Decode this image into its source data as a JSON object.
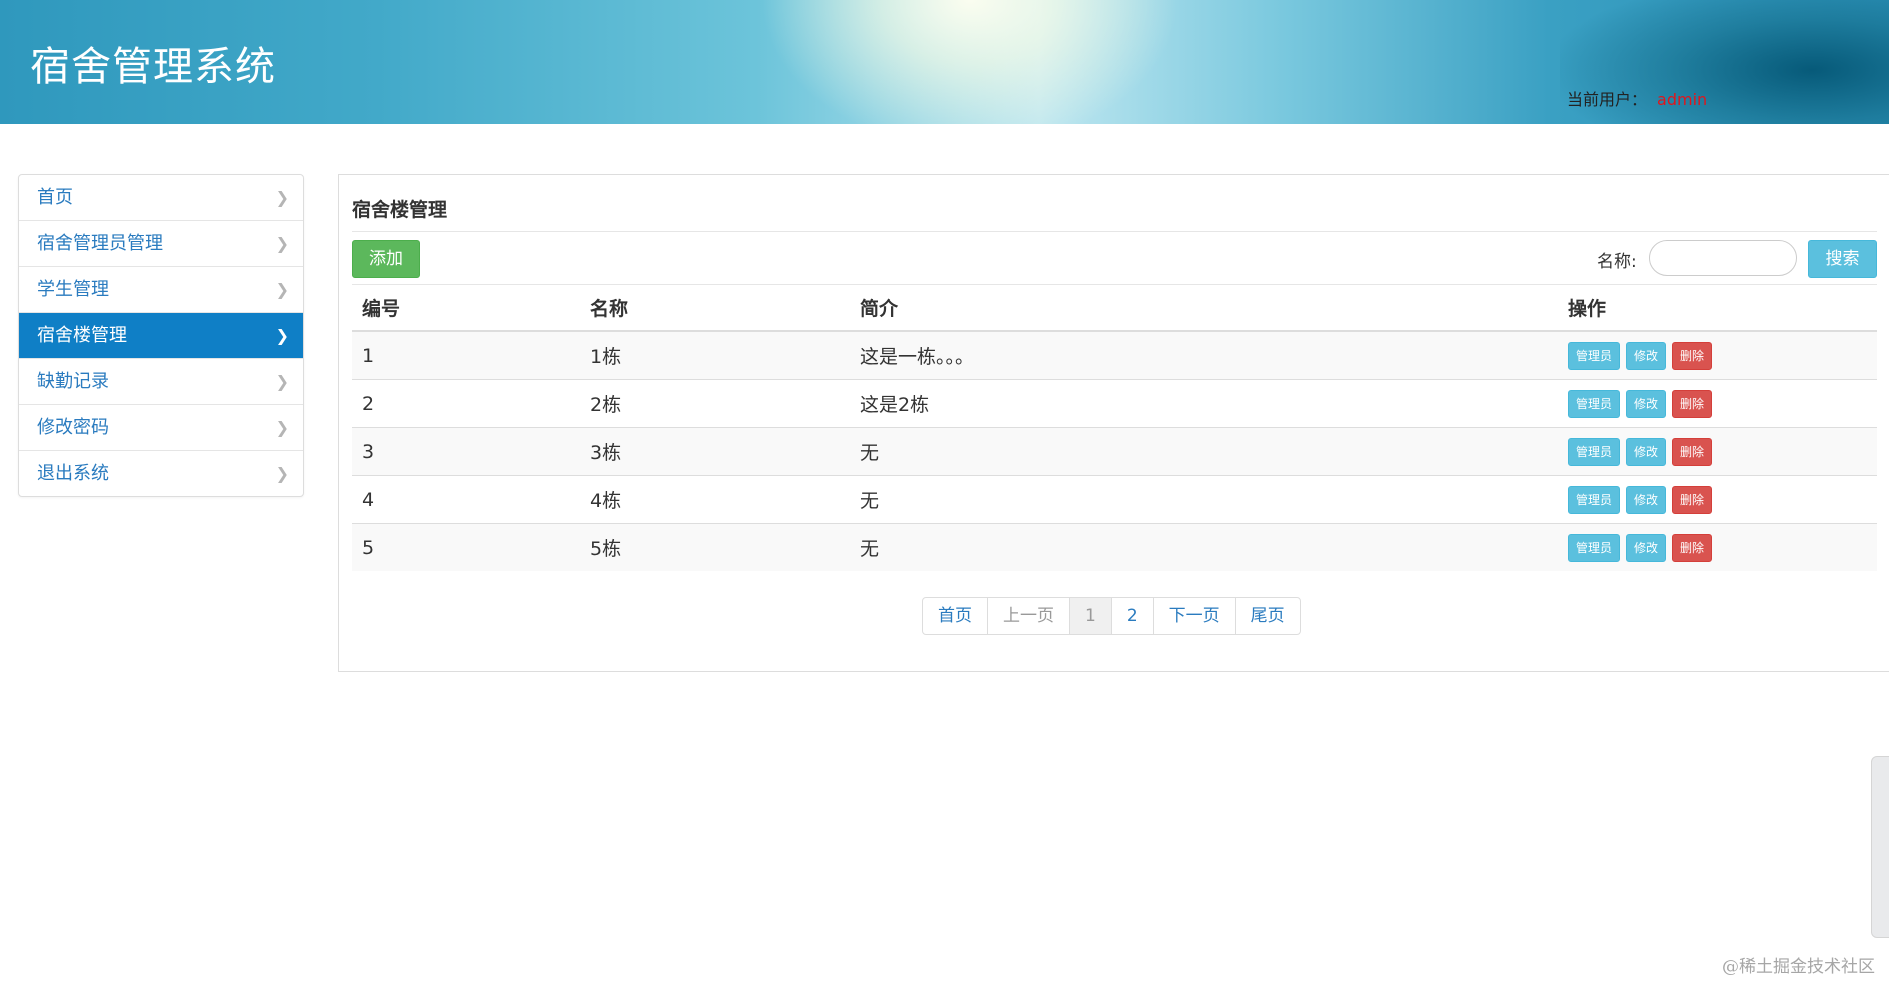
{
  "header": {
    "title": "宿舍管理系统",
    "user_label": "当前用户：",
    "user_name": "admin"
  },
  "sidebar": {
    "items": [
      {
        "label": "首页",
        "active": false
      },
      {
        "label": "宿舍管理员管理",
        "active": false
      },
      {
        "label": "学生管理",
        "active": false
      },
      {
        "label": "宿舍楼管理",
        "active": true
      },
      {
        "label": "缺勤记录",
        "active": false
      },
      {
        "label": "修改密码",
        "active": false
      },
      {
        "label": "退出系统",
        "active": false
      }
    ]
  },
  "main": {
    "title": "宿舍楼管理",
    "add_label": "添加",
    "search_label": "名称:",
    "search_value": "",
    "search_button": "搜索",
    "columns": [
      "编号",
      "名称",
      "简介",
      "操作"
    ],
    "rows": [
      {
        "id": "1",
        "name": "1栋",
        "desc": "这是一栋。。。"
      },
      {
        "id": "2",
        "name": "2栋",
        "desc": "这是2栋"
      },
      {
        "id": "3",
        "name": "3栋",
        "desc": "无"
      },
      {
        "id": "4",
        "name": "4栋",
        "desc": "无"
      },
      {
        "id": "5",
        "name": "5栋",
        "desc": "无"
      }
    ],
    "row_actions": {
      "manager": "管理员",
      "edit": "修改",
      "delete": "删除"
    },
    "pagination": {
      "first": "首页",
      "prev": "上一页",
      "pages": [
        "1",
        "2"
      ],
      "current": "1",
      "next": "下一页",
      "last": "尾页"
    }
  },
  "watermark": "@稀土掘金技术社区",
  "colors": {
    "primary": "#0f7fc6",
    "success": "#5cb85c",
    "info": "#5bc0de",
    "danger": "#d9534f",
    "username": "#e0161c"
  }
}
